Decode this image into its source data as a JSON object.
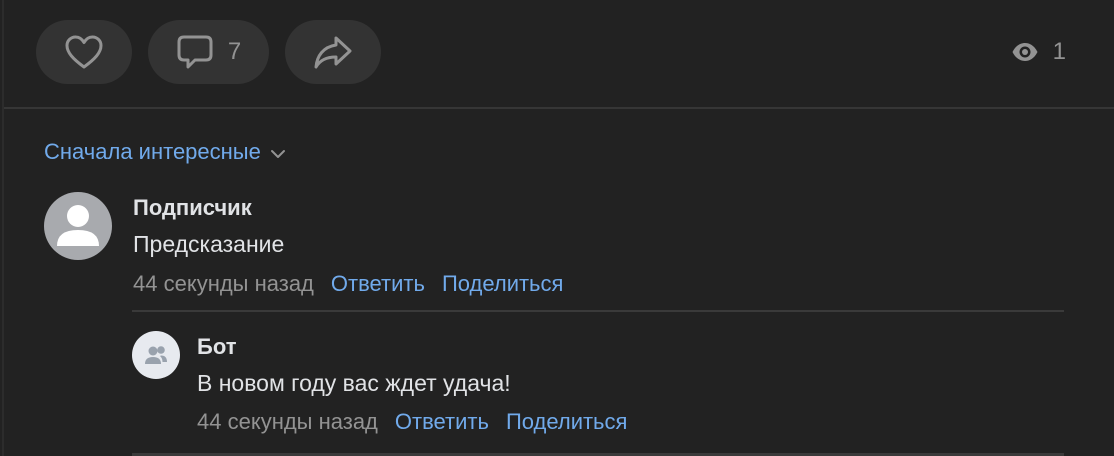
{
  "actions": {
    "comments_count": "7",
    "views_count": "1"
  },
  "sort": {
    "label": "Сначала интересные"
  },
  "comment": {
    "author": "Подписчик",
    "text": "Предсказание",
    "time": "44 секунды назад",
    "reply_label": "Ответить",
    "share_label": "Поделиться"
  },
  "reply": {
    "author": "Бот",
    "text": "В новом году вас ждет удача!",
    "time": "44 секунды назад",
    "reply_label": "Ответить",
    "share_label": "Поделиться"
  },
  "colors": {
    "background": "#222222",
    "button_bg": "#333333",
    "link": "#71aaeb",
    "text": "#e1e3e6",
    "secondary": "#939393"
  },
  "icons": [
    "heart-icon",
    "comment-icon",
    "share-icon",
    "eye-icon",
    "chevron-down-icon",
    "user-icon",
    "group-icon"
  ]
}
